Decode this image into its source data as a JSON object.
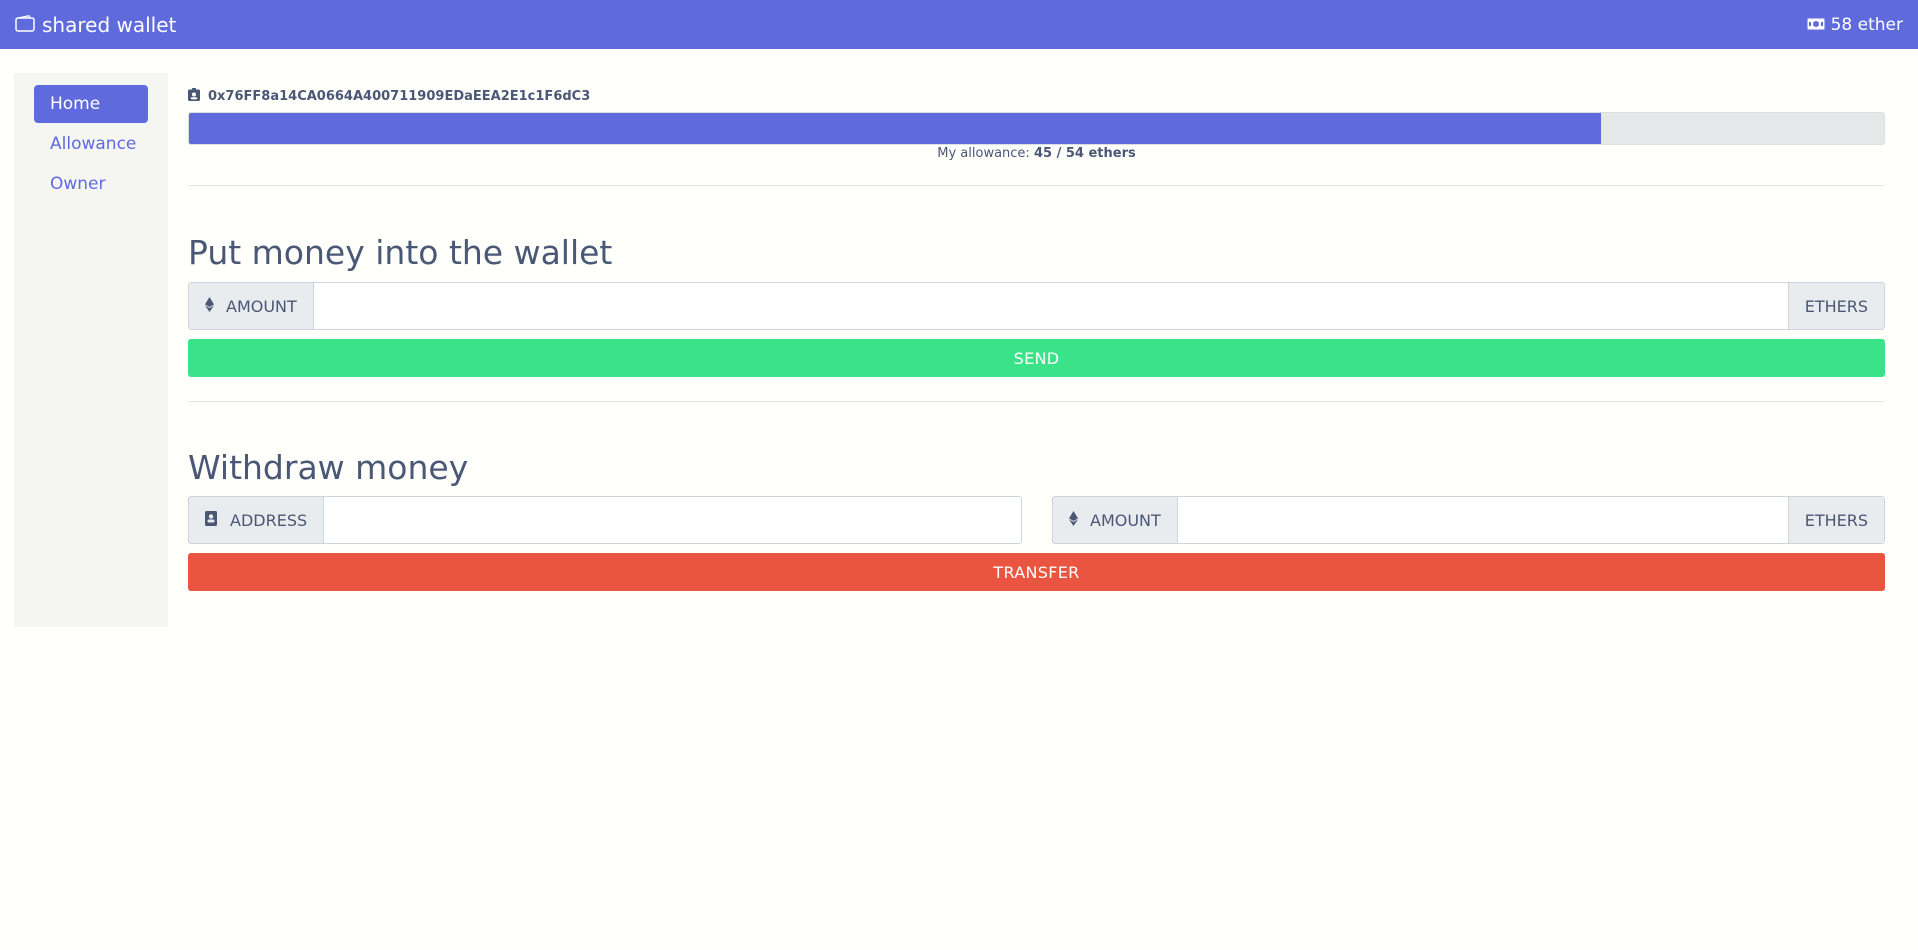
{
  "navbar": {
    "brand": "shared wallet",
    "balance": "58 ether"
  },
  "sidebar": {
    "items": [
      {
        "label": "Home",
        "active": true
      },
      {
        "label": "Allowance",
        "active": false
      },
      {
        "label": "Owner",
        "active": false
      }
    ]
  },
  "account": {
    "address": "0x76FF8a14CA0664A400711909EDaEEA2E1c1F6dC3"
  },
  "allowance": {
    "prefix": "My allowance:",
    "value": "45 / 54 ethers",
    "progress_percent": 83.3
  },
  "deposit": {
    "title": "Put money into the wallet",
    "amount_label": "AMOUNT",
    "amount_value": "",
    "unit": "ETHERS",
    "button": "SEND"
  },
  "withdraw": {
    "title": "Withdraw money",
    "address_label": "ADDRESS",
    "address_value": "",
    "amount_label": "AMOUNT",
    "amount_value": "",
    "unit": "ETHERS",
    "button": "TRANSFER"
  },
  "colors": {
    "primary": "#5f6bdd",
    "success": "#3ae387",
    "danger": "#e95540"
  },
  "icons": {
    "brand": "wallet-icon",
    "balance": "money-bill-icon",
    "address": "id-badge-icon",
    "amount": "ethereum-icon",
    "contact": "address-book-icon"
  }
}
